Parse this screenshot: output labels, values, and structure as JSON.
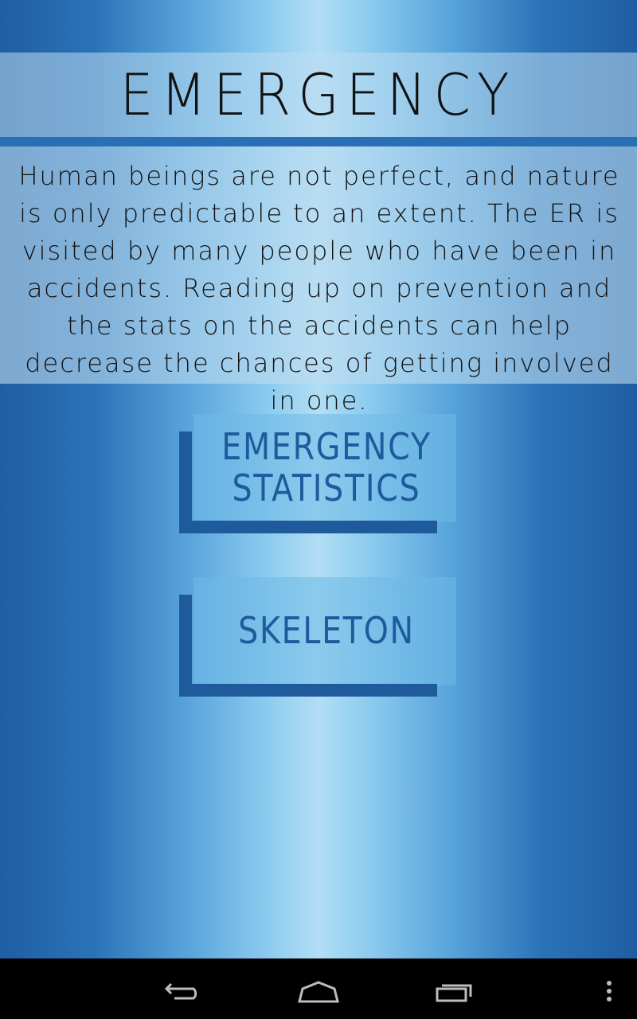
{
  "screen": {
    "title": "EMERGENCY",
    "intro": "Human beings are not perfect, and nature is only predictable to an extent. The ER is visited by many people who have been in accidents. Reading up on prevention and the stats on the accidents can help decrease the chances of getting involved in one."
  },
  "buttons": [
    {
      "label": "EMERGENCY\nSTATISTICS"
    },
    {
      "label": "SKELETON"
    }
  ],
  "nav": {
    "icons": [
      "back-icon",
      "home-icon",
      "recent-apps-icon",
      "overflow-menu-icon"
    ]
  },
  "colors": {
    "accent": "#1e5a9c",
    "navbar": "#000000"
  }
}
